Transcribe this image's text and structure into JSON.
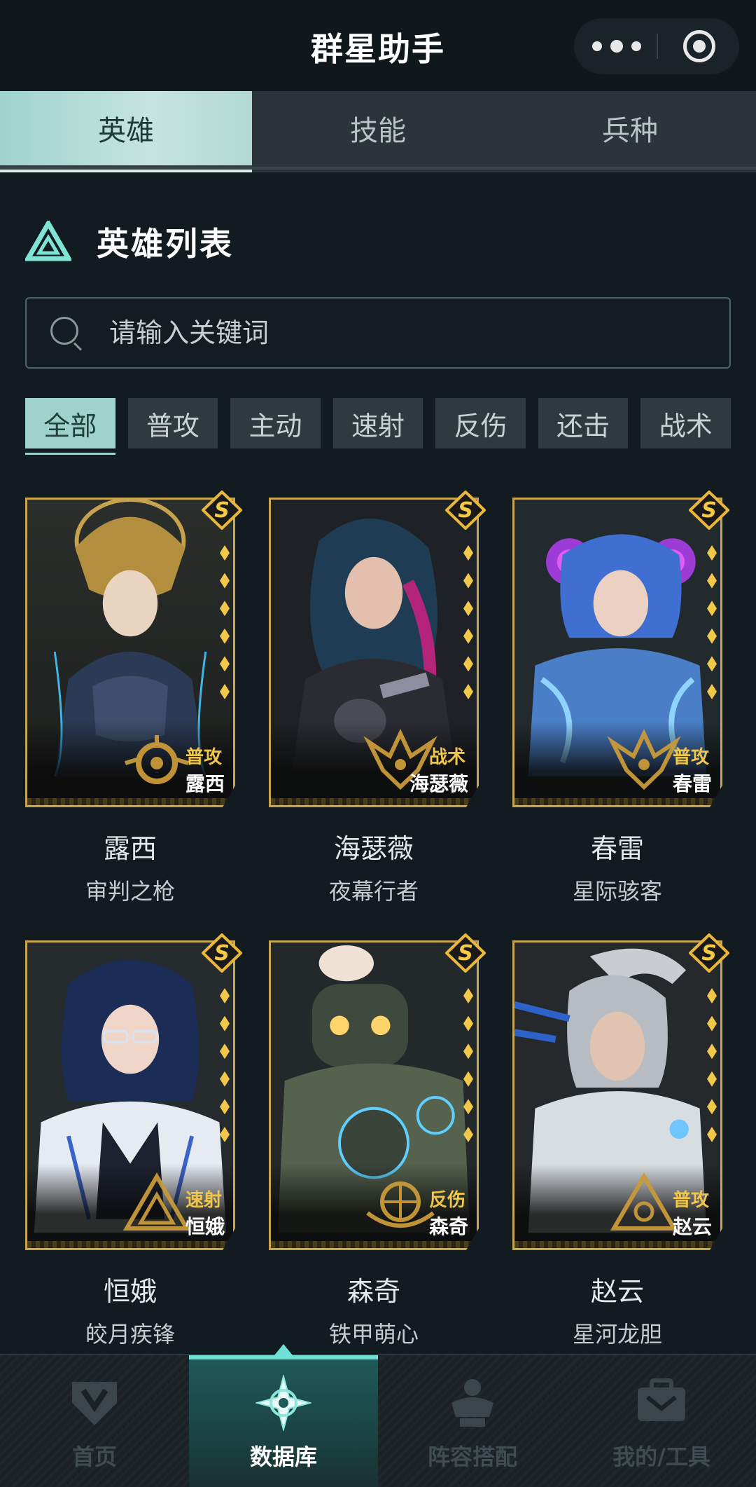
{
  "header": {
    "title": "群星助手"
  },
  "tabs": [
    {
      "label": "英雄",
      "active": true
    },
    {
      "label": "技能",
      "active": false
    },
    {
      "label": "兵种",
      "active": false
    }
  ],
  "section": {
    "title": "英雄列表"
  },
  "search": {
    "placeholder": "请输入关键词",
    "value": ""
  },
  "filters": [
    {
      "label": "全部",
      "active": true
    },
    {
      "label": "普攻"
    },
    {
      "label": "主动"
    },
    {
      "label": "速射"
    },
    {
      "label": "反伤"
    },
    {
      "label": "还击"
    },
    {
      "label": "战术"
    }
  ],
  "heroes": [
    {
      "name": "露西",
      "title": "审判之枪",
      "type": "普攻",
      "card_name": "露西",
      "rank": "S",
      "stars": 6
    },
    {
      "name": "海瑟薇",
      "title": "夜幕行者",
      "type": "战术",
      "card_name": "海瑟薇",
      "rank": "S",
      "stars": 6
    },
    {
      "name": "春雷",
      "title": "星际骇客",
      "type": "普攻",
      "card_name": "春雷",
      "rank": "S",
      "stars": 6
    },
    {
      "name": "恒娥",
      "title": "皎月疾锋",
      "type": "速射",
      "card_name": "恒娥",
      "rank": "S",
      "stars": 6
    },
    {
      "name": "森奇",
      "title": "铁甲萌心",
      "type": "反伤",
      "card_name": "森奇",
      "rank": "S",
      "stars": 6
    },
    {
      "name": "赵云",
      "title": "星河龙胆",
      "type": "普攻",
      "card_name": "赵云",
      "rank": "S",
      "stars": 6
    }
  ],
  "bottom_nav": [
    {
      "label": "首页",
      "icon": "home-shield-icon",
      "active": false
    },
    {
      "label": "数据库",
      "icon": "star-compass-icon",
      "active": true
    },
    {
      "label": "阵容搭配",
      "icon": "mech-lineup-icon",
      "active": false
    },
    {
      "label": "我的/工具",
      "icon": "toolbox-icon",
      "active": false
    }
  ],
  "colors": {
    "accent": "#9fd3c9",
    "background": "#121b20",
    "card_gold": "#c9a451",
    "type_gold": "#f0c64a"
  }
}
